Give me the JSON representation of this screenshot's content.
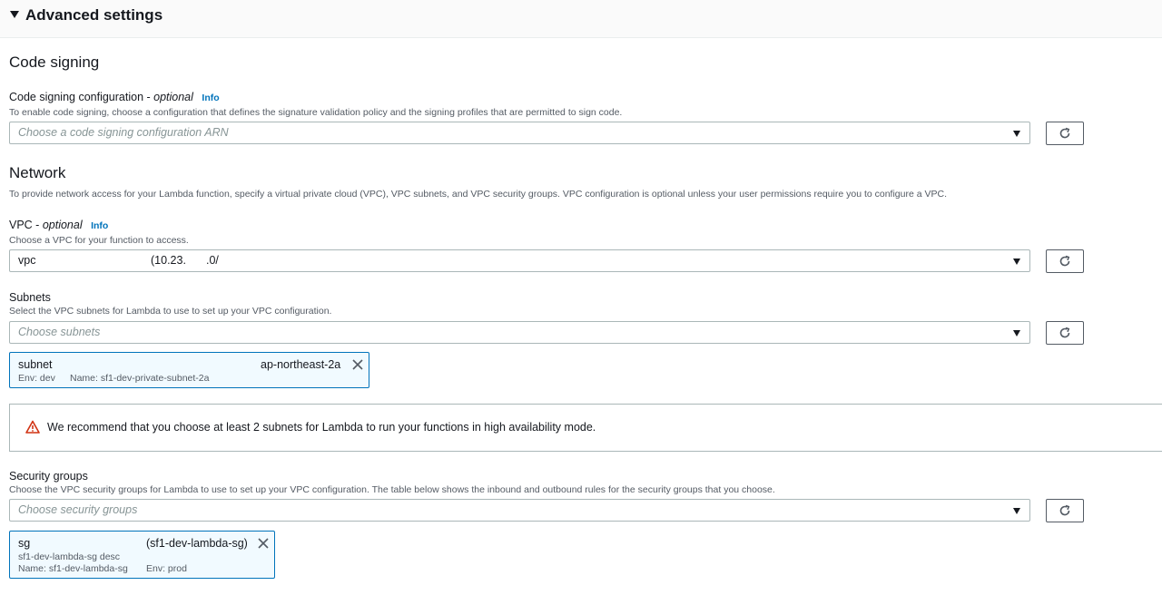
{
  "advanced": {
    "title": "Advanced settings"
  },
  "code_signing": {
    "title": "Code signing",
    "config_label": "Code signing configuration - ",
    "config_optional": "optional",
    "info": "Info",
    "config_desc": "To enable code signing, choose a configuration that defines the signature validation policy and the signing profiles that are permitted to sign code.",
    "config_placeholder": "Choose a code signing configuration ARN"
  },
  "network": {
    "title": "Network",
    "desc": "To provide network access for your Lambda function, specify a virtual private cloud (VPC), VPC subnets, and VPC security groups. VPC configuration is optional unless your user permissions require you to configure a VPC.",
    "vpc_label": "VPC - ",
    "vpc_optional": "optional",
    "vpc_info": "Info",
    "vpc_desc": "Choose a VPC for your function to access.",
    "vpc_value_prefix": "vpc",
    "vpc_value_cidr": "(10.23.",
    "vpc_value_cidr_tail": ".0/",
    "subnets_label": "Subnets",
    "subnets_desc": "Select the VPC subnets for Lambda to use to set up your VPC configuration.",
    "subnets_placeholder": "Choose subnets",
    "subnet_token": {
      "prefix": "subnet",
      "az": "ap-northeast-2a",
      "tag_env": "Env: dev",
      "tag_name": "Name: sf1-dev-private-subnet-2a"
    },
    "alert_text": "We recommend that you choose at least 2 subnets for Lambda to run your functions in high availability mode.",
    "sg_label": "Security groups",
    "sg_desc": "Choose the VPC security groups for Lambda to use to set up your VPC configuration. The table below shows the inbound and outbound rules for the security groups that you choose.",
    "sg_placeholder": "Choose security groups",
    "sg_token": {
      "prefix": "sg",
      "name": "(sf1-dev-lambda-sg)",
      "description": "sf1-dev-lambda-sg desc",
      "tag_name": "Name: sf1-dev-lambda-sg",
      "tag_env": "Env: prod"
    }
  },
  "colors": {
    "link": "#0073bb",
    "token_border": "#0073bb",
    "token_bg": "#f1faff",
    "warning": "#d13212"
  }
}
